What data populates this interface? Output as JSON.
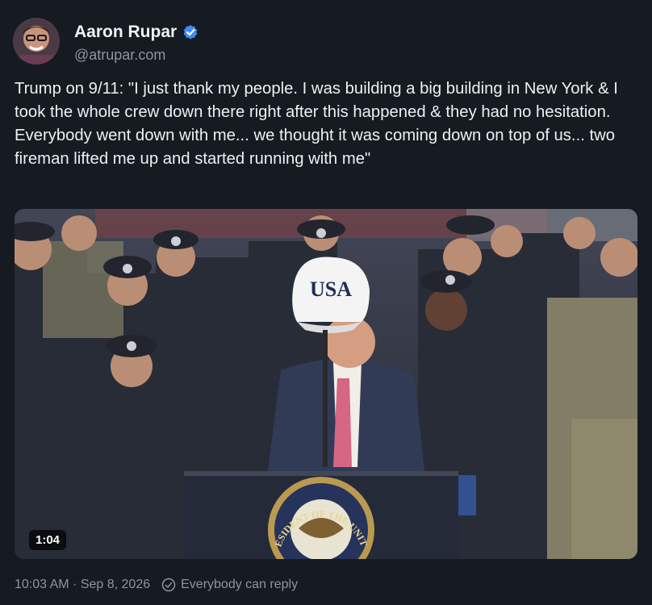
{
  "author": {
    "display_name": "Aaron Rupar",
    "handle": "@atrupar.com",
    "verified": true,
    "avatar_icon": "avatar-photo"
  },
  "post": {
    "text": "Trump on 9/11: \"I just thank my people. I was building a big building in New York & I took the whole crew down there right after this happened & they had no hesitation. Everybody went down with me... we thought it was coming down on top of us... two fireman lifted me up and started running with me\""
  },
  "video": {
    "duration": "1:04",
    "cap_text": "USA",
    "seal_text": "PRESIDENT OF THE UNITED"
  },
  "meta": {
    "timestamp": "10:03 AM · Sep 8, 2026",
    "reply_setting": "Everybody can reply"
  },
  "colors": {
    "background": "#161a21",
    "verified_blue": "#3b8df5",
    "muted_text": "#8b95a3"
  }
}
